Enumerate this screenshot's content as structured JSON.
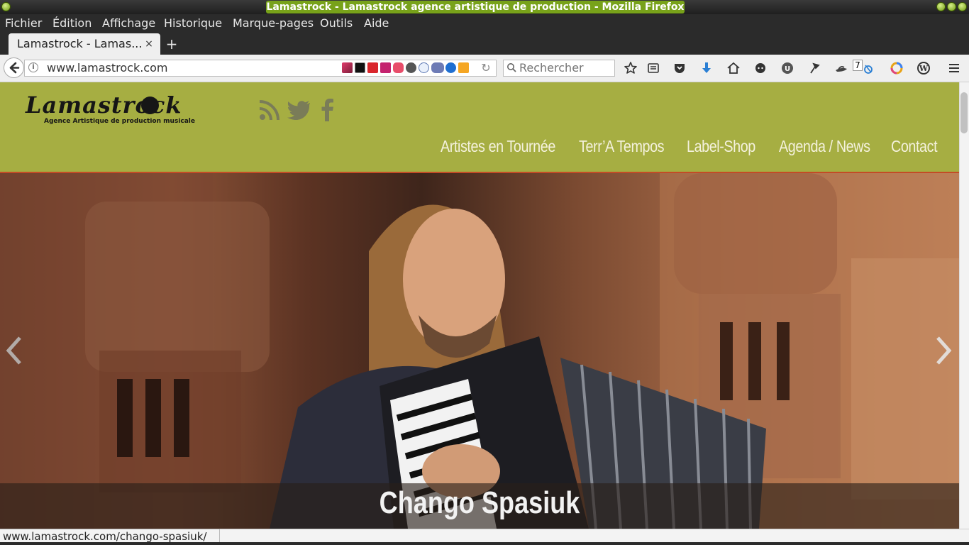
{
  "window": {
    "title": "Lamastrock - Lamastrock agence artistique de production - Mozilla Firefox",
    "accent": "#78a21a"
  },
  "menubar": {
    "items": [
      "Fichier",
      "Édition",
      "Affichage",
      "Historique",
      "Marque-pages",
      "Outils",
      "Aide"
    ]
  },
  "tab": {
    "title": "Lamastrock - Lamas...",
    "close": "×",
    "new_tab": "+"
  },
  "navbar": {
    "url": "www.lamastrock.com",
    "search_placeholder": "Rechercher",
    "badge_count": "7",
    "toolbar_icons": [
      "bookmark-star-icon",
      "reading-list-icon",
      "pocket-icon",
      "downloads-icon",
      "home-icon",
      "chat-icon",
      "ublock-icon",
      "pin-icon",
      "hat-icon",
      "extension-icon",
      "color-icon",
      "wordpress-icon",
      "hamburger-menu-icon"
    ]
  },
  "site": {
    "logo": "Lamastrock",
    "logo_subtitle": "Agence Artistique de production musicale",
    "header_color": "#a6ae42",
    "header_border_color": "#c34c25",
    "social_icons": [
      "rss-icon",
      "twitter-icon",
      "facebook-icon"
    ],
    "nav": [
      "Artistes en Tournée",
      "Terr’A Tempos",
      "Label-Shop",
      "Agenda / News",
      "Contact"
    ]
  },
  "hero": {
    "caption": "Chango Spasiuk"
  },
  "status": {
    "url": "www.lamastrock.com/chango-spasiuk/"
  }
}
